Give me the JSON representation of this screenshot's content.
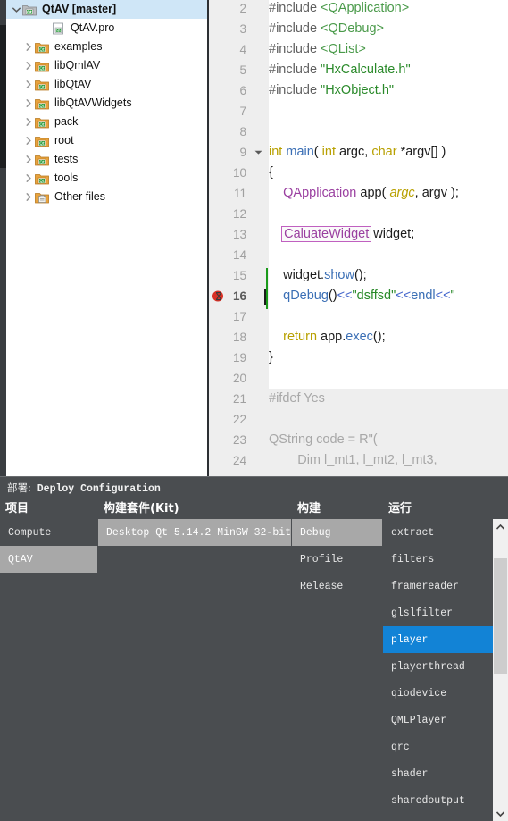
{
  "sidebar": {
    "items": [
      {
        "label": "QtAV [master]",
        "icon": "folder-project-icon",
        "depth": 0,
        "arrow": "down",
        "selected": true,
        "bold": true
      },
      {
        "label": "QtAV.pro",
        "icon": "file-pro-icon",
        "depth": 2,
        "arrow": "none",
        "selected": false,
        "bold": false
      },
      {
        "label": "examples",
        "icon": "folder-qt-icon",
        "depth": 1,
        "arrow": "right",
        "selected": false,
        "bold": false
      },
      {
        "label": "libQmlAV",
        "icon": "folder-qt-icon",
        "depth": 1,
        "arrow": "right",
        "selected": false,
        "bold": false
      },
      {
        "label": "libQtAV",
        "icon": "folder-qt-icon",
        "depth": 1,
        "arrow": "right",
        "selected": false,
        "bold": false
      },
      {
        "label": "libQtAVWidgets",
        "icon": "folder-qt-icon",
        "depth": 1,
        "arrow": "right",
        "selected": false,
        "bold": false
      },
      {
        "label": "pack",
        "icon": "folder-qt-icon",
        "depth": 1,
        "arrow": "right",
        "selected": false,
        "bold": false
      },
      {
        "label": "root",
        "icon": "folder-qt-icon",
        "depth": 1,
        "arrow": "right",
        "selected": false,
        "bold": false
      },
      {
        "label": "tests",
        "icon": "folder-qt-icon",
        "depth": 1,
        "arrow": "right",
        "selected": false,
        "bold": false
      },
      {
        "label": "tools",
        "icon": "folder-qt-icon",
        "depth": 1,
        "arrow": "right",
        "selected": false,
        "bold": false
      },
      {
        "label": "Other files",
        "icon": "folder-other-icon",
        "depth": 1,
        "arrow": "right",
        "selected": false,
        "bold": false
      }
    ]
  },
  "editor": {
    "first_line": 2,
    "breakpoint_line": 16,
    "caret_line": 16,
    "current_line_marker_lines": [
      15,
      16
    ],
    "fold_marker_line": 9,
    "inactive_block_start_line": 21,
    "error_underlined_token": "CaluateWidget",
    "lines": [
      {
        "n": 2,
        "text": "#include <QApplication>"
      },
      {
        "n": 3,
        "text": "#include <QDebug>"
      },
      {
        "n": 4,
        "text": "#include <QList>"
      },
      {
        "n": 5,
        "text": "#include \"HxCalculate.h\""
      },
      {
        "n": 6,
        "text": "#include \"HxObject.h\""
      },
      {
        "n": 7,
        "text": ""
      },
      {
        "n": 8,
        "text": ""
      },
      {
        "n": 9,
        "text": "int main( int argc, char *argv[] )"
      },
      {
        "n": 10,
        "text": "{"
      },
      {
        "n": 11,
        "text": "    QApplication app( argc, argv );"
      },
      {
        "n": 12,
        "text": ""
      },
      {
        "n": 13,
        "text": "    CaluateWidget widget;"
      },
      {
        "n": 14,
        "text": ""
      },
      {
        "n": 15,
        "text": "    widget.show();"
      },
      {
        "n": 16,
        "text": "    qDebug()<<\"dsffsd\"<<endl<<\""
      },
      {
        "n": 17,
        "text": ""
      },
      {
        "n": 18,
        "text": "    return app.exec();"
      },
      {
        "n": 19,
        "text": "}"
      },
      {
        "n": 20,
        "text": ""
      },
      {
        "n": 21,
        "text": "#ifdef Yes"
      },
      {
        "n": 22,
        "text": ""
      },
      {
        "n": 23,
        "text": "QString code = R\"("
      },
      {
        "n": 24,
        "text": "        Dim l_mt1, l_mt2, l_mt3,"
      }
    ]
  },
  "deploy_panel": {
    "title_prefix": "部署:",
    "title": "Deploy Configuration",
    "columns": [
      {
        "key": "project",
        "label": "项目"
      },
      {
        "key": "kit",
        "label": "构建套件(Kit)"
      },
      {
        "key": "build",
        "label": "构建"
      },
      {
        "key": "run",
        "label": "运行"
      }
    ],
    "project_items": [
      {
        "label": "Compute",
        "selected": false
      },
      {
        "label": "QtAV",
        "selected": true
      }
    ],
    "kit_items": [
      {
        "label": "Desktop Qt 5.14.2 MinGW 32-bit",
        "selected": true
      }
    ],
    "build_items": [
      {
        "label": "Debug",
        "selected": true
      },
      {
        "label": "Profile",
        "selected": false
      },
      {
        "label": "Release",
        "selected": false
      }
    ],
    "run_items": [
      {
        "label": "extract",
        "selected": false
      },
      {
        "label": "filters",
        "selected": false
      },
      {
        "label": "framereader",
        "selected": false
      },
      {
        "label": "glslfilter",
        "selected": false
      },
      {
        "label": "player",
        "selected": true
      },
      {
        "label": "playerthread",
        "selected": false
      },
      {
        "label": "qiodevice",
        "selected": false
      },
      {
        "label": "QMLPlayer",
        "selected": false
      },
      {
        "label": "qrc",
        "selected": false
      },
      {
        "label": "shader",
        "selected": false
      },
      {
        "label": "sharedoutput",
        "selected": false
      }
    ],
    "scrollbar": {
      "up_arrow": "▲",
      "down_arrow": "▼"
    }
  },
  "colors": {
    "selection_blue": "#1283d6",
    "selection_grey": "#a8a8a8",
    "panel_bg": "#4a4d50",
    "tree_selection": "#cfe6f7",
    "breakpoint_red": "#d93025",
    "current_line_green": "#1a9a1a"
  }
}
